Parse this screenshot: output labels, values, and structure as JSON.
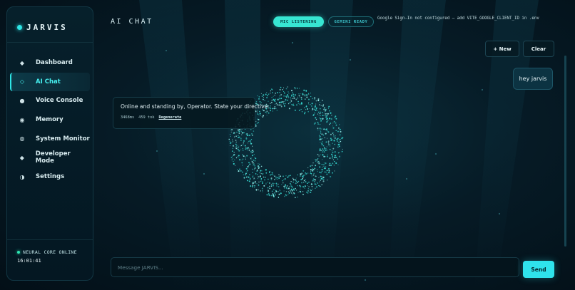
{
  "sidebar": {
    "brand": "JARVIS",
    "items": [
      {
        "label": "Dashboard",
        "icon": "diamond-icon",
        "active": false
      },
      {
        "label": "AI Chat",
        "icon": "diamond-outline-icon",
        "active": true
      },
      {
        "label": "Voice Console",
        "icon": "circle-icon",
        "active": false
      },
      {
        "label": "Memory",
        "icon": "memory-icon",
        "active": false
      },
      {
        "label": "System Monitor",
        "icon": "monitor-icon",
        "active": false
      },
      {
        "label": "Developer Mode",
        "icon": "diamond-icon",
        "active": false
      },
      {
        "label": "Settings",
        "icon": "half-circle-icon",
        "active": false
      }
    ],
    "status": "NEURAL CORE ONLINE",
    "clock": "16:01:41"
  },
  "header": {
    "title": "AI CHAT",
    "badges": {
      "mic": "MIC LISTENING",
      "gemini": "GEMINI READY"
    },
    "google_note": "Google Sign-In not configured — add VITE_GOOGLE_CLIENT_ID in .env"
  },
  "toolbar": {
    "new_label": "+ New",
    "clear_label": "Clear"
  },
  "messages": {
    "user": "hey jarvis",
    "assistant": {
      "text": "Online and standing by, Operator. State your directive.",
      "latency": "3468ms",
      "tokens": "459 tok",
      "regenerate": "Regenerate"
    }
  },
  "composer": {
    "placeholder": "Message JARVIS...",
    "value": "",
    "send_label": "Send"
  },
  "colors": {
    "accent": "#2ee6e6",
    "background": "#020c14",
    "panel": "#06202b"
  }
}
